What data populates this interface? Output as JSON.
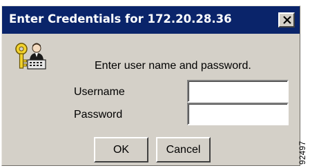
{
  "dialog": {
    "title": "Enter Credentials for 172.20.28.36",
    "icon": "key-and-user-icon",
    "prompt": "Enter user name and password.",
    "username": {
      "label": "Username",
      "value": "",
      "placeholder": ""
    },
    "password": {
      "label": "Password",
      "value": "",
      "placeholder": ""
    },
    "buttons": {
      "ok_label": "OK",
      "cancel_label": "Cancel"
    },
    "close_icon": "close-icon"
  },
  "figure_id": "92497",
  "colors": {
    "title_bar": "#0a246a",
    "dialog_face": "#d4d0c8",
    "title_text": "#ffffff"
  }
}
